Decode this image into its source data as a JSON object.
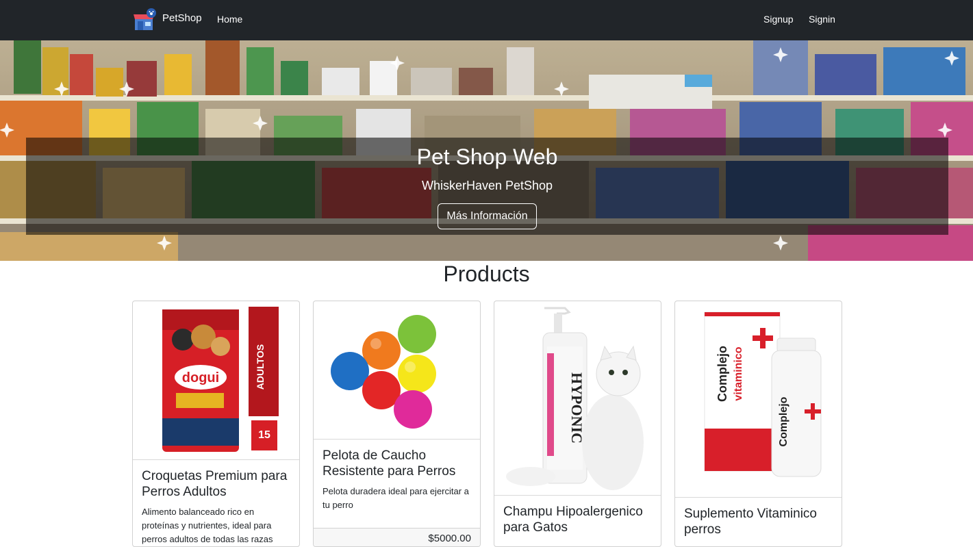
{
  "navbar": {
    "brand": "PetShop",
    "home": "Home",
    "signup": "Signup",
    "signin": "Signin"
  },
  "hero": {
    "title": "Pet Shop Web",
    "subtitle": "WhiskerHaven PetShop",
    "button": "Más Información"
  },
  "products": {
    "heading": "Products",
    "items": [
      {
        "title": "Croquetas Premium para Perros Adultos",
        "description": "Alimento balanceado rico en proteínas y nutrientes, ideal para perros adultos de todas las razas"
      },
      {
        "title": "Pelota de Caucho Resistente para Perros",
        "description": "Pelota duradera ideal para ejercitar a tu perro",
        "price": "$5000.00"
      },
      {
        "title": "Champu Hipoalergenico para Gatos",
        "description": ""
      },
      {
        "title": "Suplemento Vitaminico perros",
        "description": ""
      }
    ]
  },
  "colors": {
    "navbar_bg": "#212529",
    "caption_bg": "rgba(0,0,0,0.55)",
    "accent_red": "#d81f2a"
  }
}
